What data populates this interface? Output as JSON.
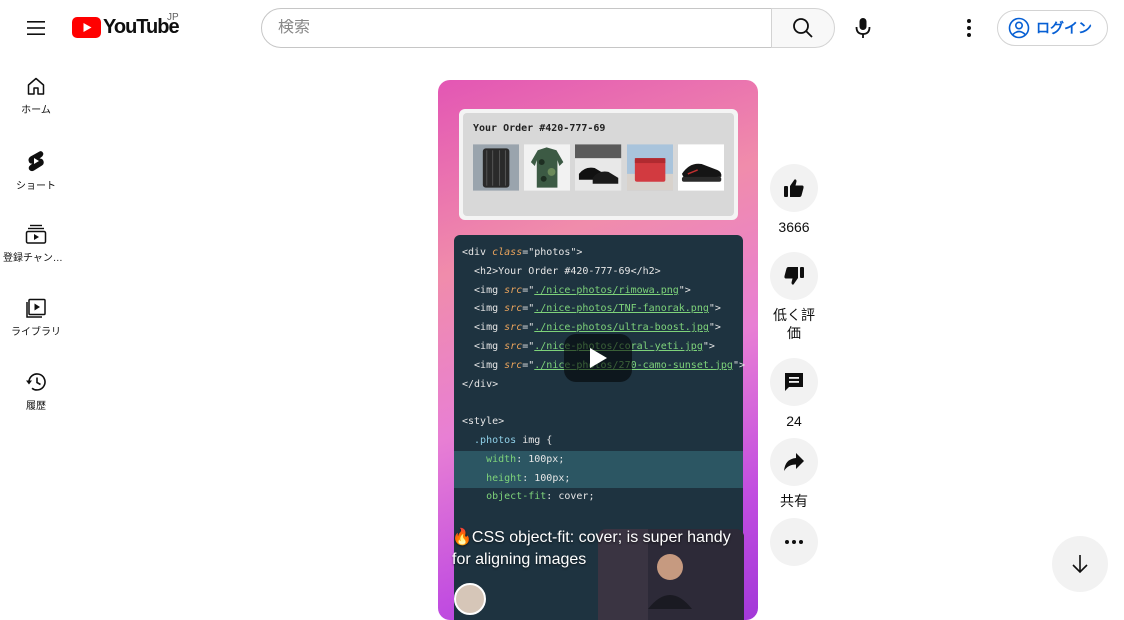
{
  "header": {
    "logo_text": "YouTube",
    "region_code": "JP",
    "search_placeholder": "検索",
    "login_label": "ログイン"
  },
  "sidebar": {
    "items": [
      {
        "label": "ホーム",
        "icon": "home-icon"
      },
      {
        "label": "ショート",
        "icon": "shorts-icon"
      },
      {
        "label": "登録チャンネル",
        "icon": "subscriptions-icon"
      },
      {
        "label": "ライブラリ",
        "icon": "library-icon"
      },
      {
        "label": "履歴",
        "icon": "history-icon"
      }
    ]
  },
  "video": {
    "order_title": "Your Order #420-777-69",
    "code_lines": [
      "<div class=\"photos\">",
      "  <h2>Your Order #420-777-69</h2>",
      "  <img src=\"./nice-photos/rimowa.png\">",
      "  <img src=\"./nice-photos/TNF-fanorak.png\">",
      "  <img src=\"./nice-photos/ultra-boost.jpg\">",
      "  <img src=\"./nice-photos/coral-yeti.jpg\">",
      "  <img src=\"./nice-photos/270-camo-sunset.jpg\">",
      "</div>",
      "",
      "<style>",
      "  .photos img {",
      "    width: 100px;",
      "    height: 100px;",
      "    object-fit: cover;"
    ],
    "title": "🔥CSS object-fit: cover; is super handy for aligning images"
  },
  "actions": {
    "like_count": "3666",
    "dislike_label": "低く評価",
    "comment_count": "24",
    "share_label": "共有"
  },
  "colors": {
    "brand_red": "#ff0000",
    "link_blue": "#065fd4"
  }
}
